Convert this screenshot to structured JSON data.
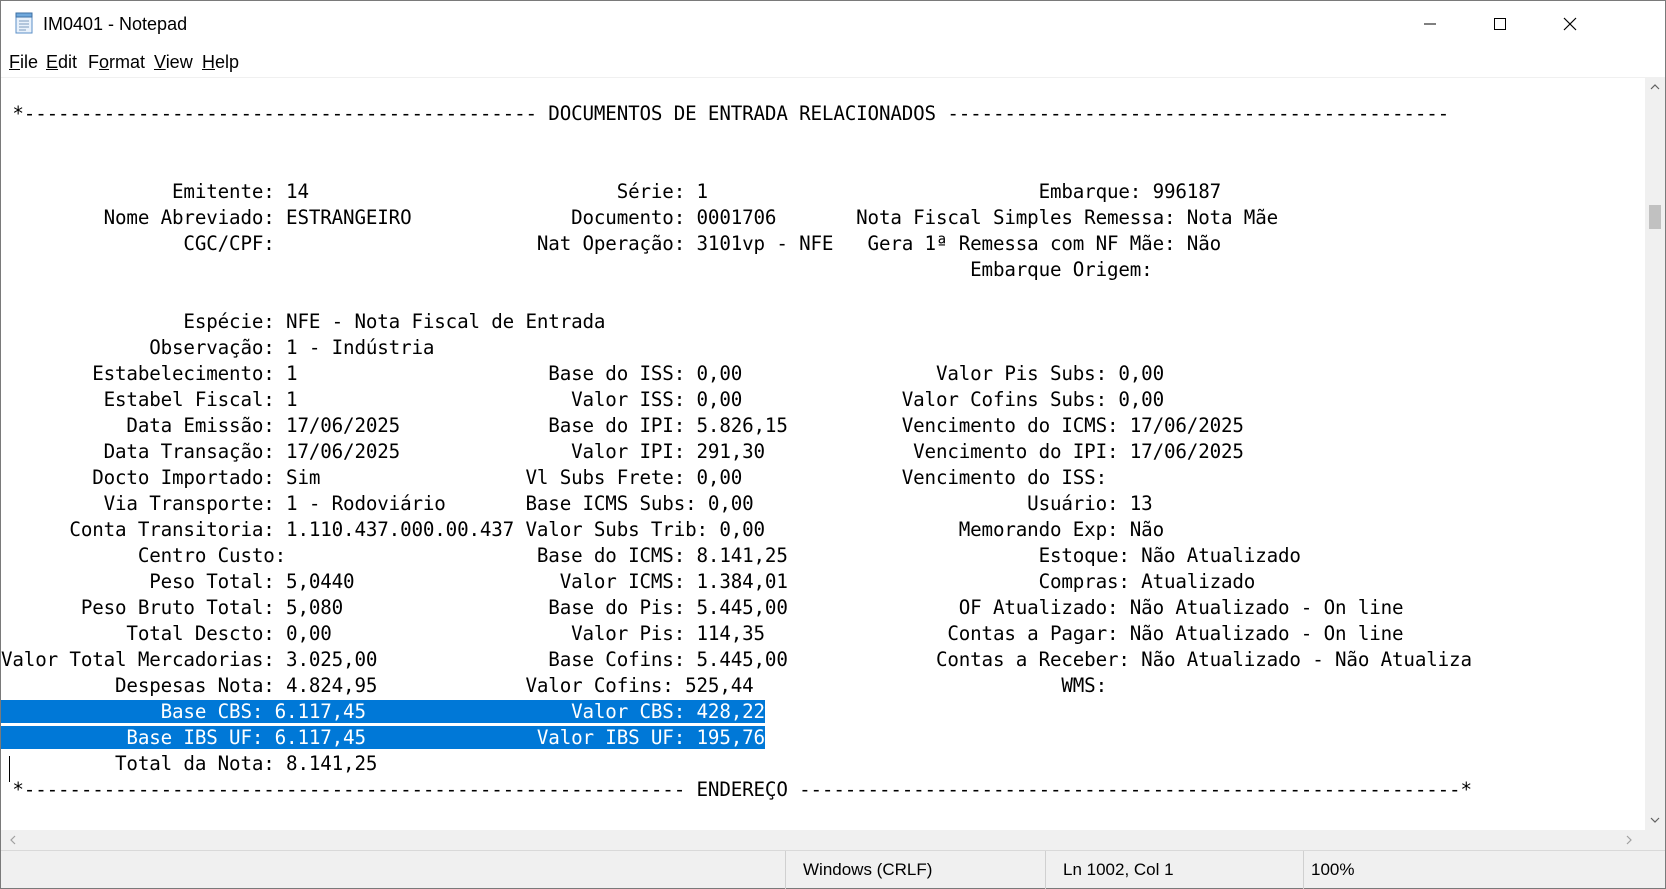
{
  "window": {
    "title": "IM0401 - Notepad",
    "icon": "notepad-icon"
  },
  "menu": [
    {
      "label": "File",
      "accel": "F",
      "rest": "ile"
    },
    {
      "label": "Edit",
      "accel": "E",
      "rest": "dit"
    },
    {
      "label": "Format",
      "accel": "o",
      "pre": "F",
      "rest": "rmat"
    },
    {
      "label": "View",
      "accel": "V",
      "rest": "iew"
    },
    {
      "label": "Help",
      "accel": "H",
      "rest": "elp"
    }
  ],
  "document": {
    "lines": [
      " *--------------------------------------------- DOCUMENTOS DE ENTRADA RELACIONADOS --------------------------------------------",
      "",
      "",
      "               Emitente: 14                           Série: 1                             Embarque: 996187",
      "         Nome Abreviado: ESTRANGEIRO              Documento: 0001706       Nota Fiscal Simples Remessa: Nota Mãe",
      "                CGC/CPF:                       Nat Operação: 3101vp - NFE   Gera 1ª Remessa com NF Mãe: Não",
      "                                                                                     Embarque Origem:",
      "",
      "                Espécie: NFE - Nota Fiscal de Entrada",
      "             Observação: 1 - Indústria",
      "        Estabelecimento: 1                      Base do ISS: 0,00                 Valor Pis Subs: 0,00",
      "         Estabel Fiscal: 1                        Valor ISS: 0,00              Valor Cofins Subs: 0,00",
      "           Data Emissão: 17/06/2025             Base do IPI: 5.826,15          Vencimento do ICMS: 17/06/2025",
      "         Data Transação: 17/06/2025               Valor IPI: 291,30             Vencimento do IPI: 17/06/2025",
      "        Docto Importado: Sim                  Vl Subs Frete: 0,00              Vencimento do ISS:",
      "         Via Transporte: 1 - Rodoviário       Base ICMS Subs: 0,00                        Usuário: 13",
      "      Conta Transitoria: 1.110.437.000.00.437 Valor Subs Trib: 0,00                 Memorando Exp: Não",
      "            Centro Custo:                      Base do ICMS: 8.141,25                      Estoque: Não Atualizado",
      "             Peso Total: 5,0440                  Valor ICMS: 1.384,01                      Compras: Atualizado",
      "       Peso Bruto Total: 5,080                  Base do Pis: 5.445,00               OF Atualizado: Não Atualizado - On line",
      "           Total Descto: 0,00                     Valor Pis: 114,35                Contas a Pagar: Não Atualizado - On line",
      "Valor Total Mercadorias: 3.025,00               Base Cofins: 5.445,00             Contas a Receber: Não Atualizado - Não Atualiza",
      "          Despesas Nota: 4.824,95             Valor Cofins: 525,44                           WMS:"
    ],
    "selected_lines": [
      "              Base CBS: 6.117,45                  Valor CBS: 428,22",
      "           Base IBS UF: 6.117,45               Valor IBS UF: 195,76"
    ],
    "after_lines": [
      "          Total da Nota: 8.141,25",
      " *---------------------------------------------------------- ENDEREÇO ----------------------------------------------------------*"
    ]
  },
  "status": {
    "line_ending": "Windows (CRLF)",
    "position": "Ln 1002, Col 1",
    "zoom": "100%"
  }
}
